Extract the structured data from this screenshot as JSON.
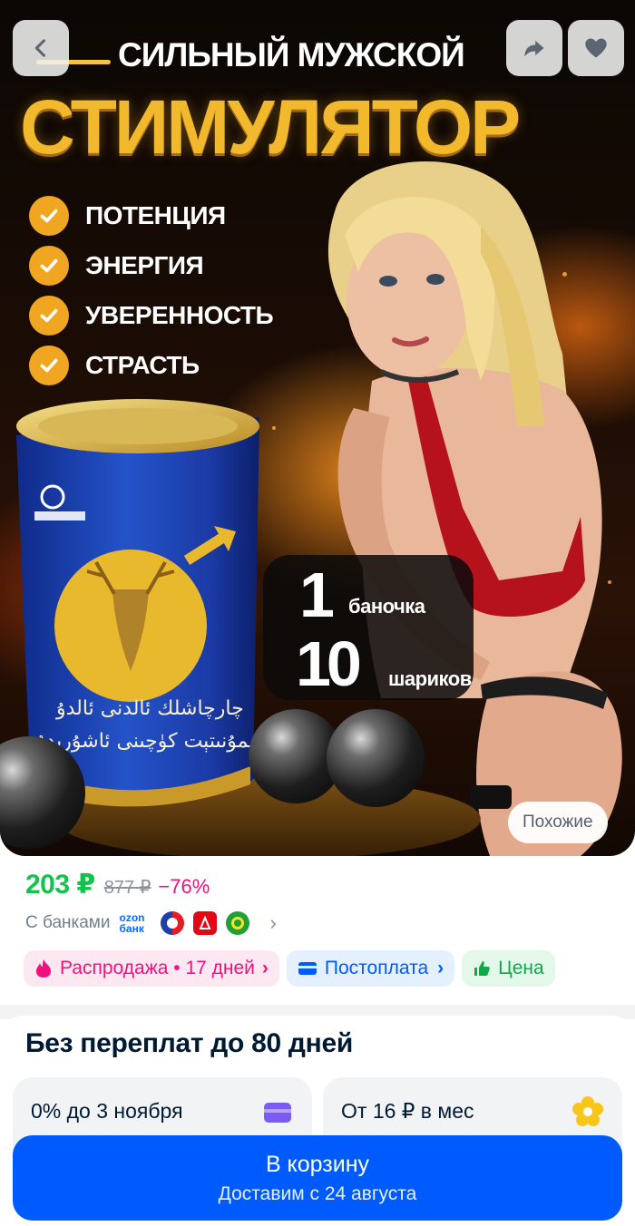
{
  "hero": {
    "title_top": "СИЛЬНЫЙ МУЖСКОЙ",
    "title_main": "СТИМУЛЯТОР",
    "benefits": [
      "ПОТЕНЦИЯ",
      "ЭНЕРГИЯ",
      "УВЕРЕННОСТЬ",
      "СТРАСТЬ"
    ],
    "badge": {
      "num1": "1",
      "unit1": "баночка",
      "num2": "10",
      "unit2": "шариков"
    },
    "can_script_line1": "چارچاشلك ئالدنى ئالدۇ",
    "can_script_line2": "ئىممۇنىتېت كۈچىنى ئاشۇرىدۇ",
    "similar_label": "Похожие",
    "icons": [
      "back-arrow-icon",
      "share-icon",
      "heart-icon"
    ]
  },
  "price": {
    "current": "203 ₽",
    "old": "877 ₽",
    "discount": "−76%",
    "banks_label": "С банками",
    "ozon_bank": [
      "ozon",
      "банк"
    ]
  },
  "chips": {
    "sale": "Распродажа • 17 дней",
    "postpay": "Постоплата",
    "price": "Цена"
  },
  "installments": {
    "title": "Без переплат до 80 дней",
    "card1": "0% до 3 ноября",
    "card2": "От 16 ₽ в мес"
  },
  "cart": {
    "title": "В корзину",
    "subtitle": "Доставим с 24 августа"
  },
  "colors": {
    "accent": "#005bff",
    "price_green": "#10c44c",
    "discount_pink": "#f1117e",
    "title_gold": "#f3b92c"
  }
}
